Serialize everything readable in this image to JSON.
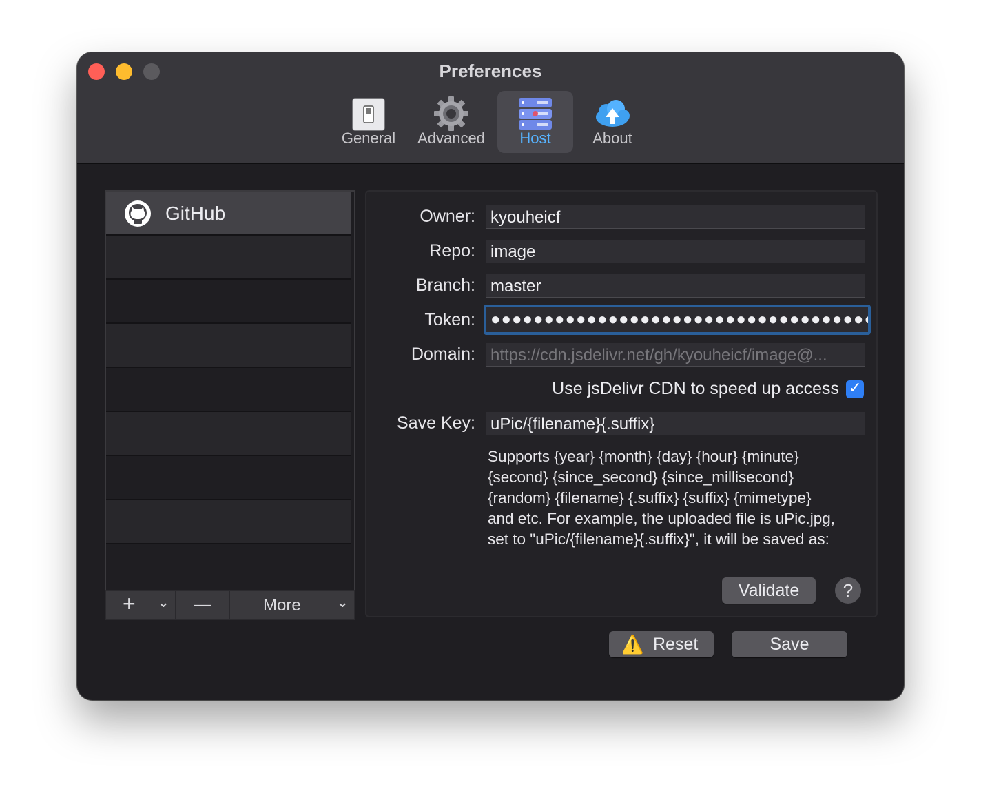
{
  "window": {
    "title": "Preferences"
  },
  "tabs": [
    {
      "id": "general",
      "label": "General",
      "icon": "switch-icon"
    },
    {
      "id": "advanced",
      "label": "Advanced",
      "icon": "gear-icon"
    },
    {
      "id": "host",
      "label": "Host",
      "icon": "server-icon",
      "active": true
    },
    {
      "id": "about",
      "label": "About",
      "icon": "cloud-upload-icon"
    }
  ],
  "hosts": {
    "items": [
      {
        "label": "GitHub",
        "icon": "github-icon",
        "selected": true
      }
    ],
    "toolbar": {
      "add": "+",
      "add_menu": "⌄",
      "remove": "—",
      "more": "More",
      "more_menu": "⌄"
    }
  },
  "form": {
    "owner": {
      "label": "Owner:",
      "value": "kyouheicf"
    },
    "repo": {
      "label": "Repo:",
      "value": "image"
    },
    "branch": {
      "label": "Branch:",
      "value": "master"
    },
    "token": {
      "label": "Token:",
      "value": "●●●●●●●●●●●●●●●●●●●●●●●●●●●●●●●●●●●●●●●●"
    },
    "domain": {
      "label": "Domain:",
      "value": "https://cdn.jsdelivr.net/gh/kyouheicf/image@..."
    },
    "cdn": {
      "label": "Use jsDelivr CDN to speed up access",
      "checked": true,
      "check_glyph": "✓"
    },
    "save_key": {
      "label": "Save Key:",
      "value": "uPic/{filename}{.suffix}"
    },
    "help_lines": [
      "Supports {year} {month} {day} {hour} {minute}",
      "{second} {since_second} {since_millisecond}",
      "{random} {filename} {.suffix} {suffix} {mimetype}",
      "and etc. For example, the uploaded file is uPic.jpg,",
      "set to \"uPic/{filename}{.suffix}\", it will be saved as:"
    ]
  },
  "buttons": {
    "validate": "Validate",
    "help": "?",
    "reset": "Reset",
    "reset_icon": "⚠️",
    "save": "Save"
  },
  "colors": {
    "accent": "#2f7ff5",
    "active_tab_label": "#57b3ff",
    "close": "#ff5f57",
    "minimize": "#febc2e",
    "warning": "#f5c518"
  }
}
